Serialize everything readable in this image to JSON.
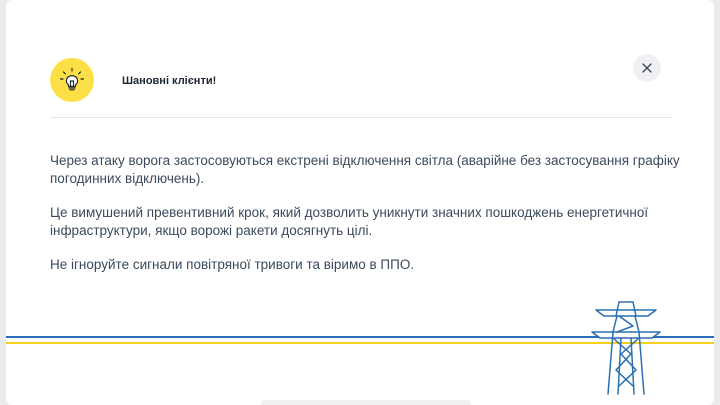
{
  "modal": {
    "title": "Шановні клієнти!",
    "paragraphs": [
      "Через атаку ворога застосовуються екстрені відключення світла (аварійне без застосування графіку погодинних відключень).",
      "Це вимушений превентивний крок, який дозволить уникнути значних пошкоджень енергетичної інфраструктури, якщо ворожі ракети досягнуть цілі.",
      "Не ігноруйте сигнали повітряної тривоги та віримо в ППО."
    ],
    "icons": {
      "badge": "lightbulb-icon",
      "close": "close-icon",
      "decoration": "power-pylon-icon"
    }
  },
  "colors": {
    "badge_bg": "#fde047",
    "stripe_blue": "#2b6fb3",
    "stripe_yellow": "#f5d020"
  }
}
